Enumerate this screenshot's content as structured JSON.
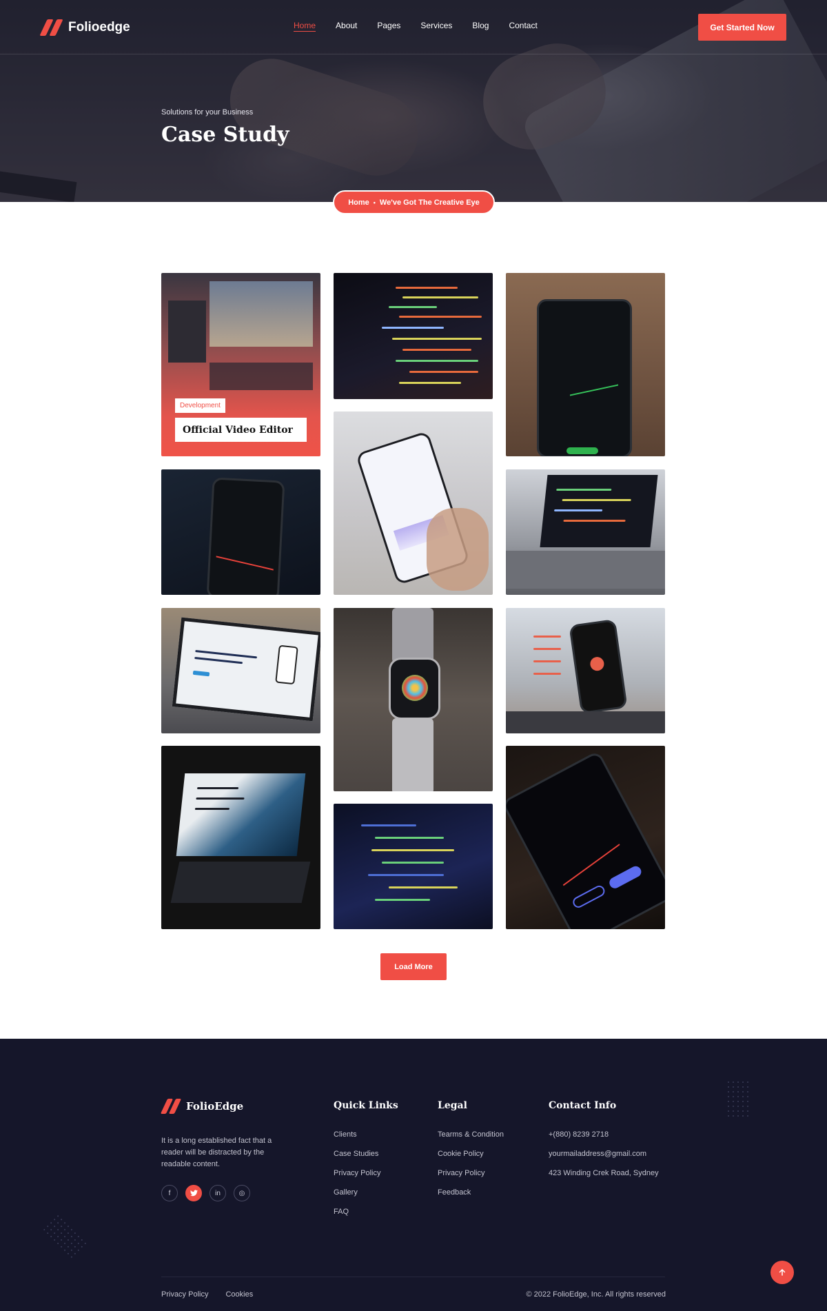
{
  "nav": {
    "brand": "Folioedge",
    "items": [
      {
        "label": "Home",
        "active": true
      },
      {
        "label": "About"
      },
      {
        "label": "Pages"
      },
      {
        "label": "Services"
      },
      {
        "label": "Blog"
      },
      {
        "label": "Contact"
      }
    ],
    "cta": "Get Started Now"
  },
  "hero": {
    "subtitle": "Solutions for your Business",
    "title": "Case Study"
  },
  "breadcrumb": {
    "home": "Home",
    "separator": "•",
    "current": "We've Got The Creative Eye"
  },
  "portfolio": {
    "featured": {
      "category": "Development",
      "title": "Official Video Editor"
    },
    "load_more": "Load More"
  },
  "footer": {
    "brand": "FolioEdge",
    "about": "It is a long established fact that a reader will be distracted by the readable content.",
    "socials": [
      {
        "icon": "facebook-icon",
        "glyph": "f"
      },
      {
        "icon": "twitter-icon",
        "glyph": "🐦",
        "active": true
      },
      {
        "icon": "linkedin-icon",
        "glyph": "in"
      },
      {
        "icon": "instagram-icon",
        "glyph": "◎"
      }
    ],
    "quick_links": {
      "heading": "Quick Links",
      "items": [
        "Clients",
        "Case Studies",
        "Privacy Policy",
        "Gallery",
        "FAQ"
      ]
    },
    "legal": {
      "heading": "Legal",
      "items": [
        "Tearms & Condition",
        "Cookie Policy",
        "Privacy Policy",
        "Feedback"
      ]
    },
    "contact": {
      "heading": "Contact Info",
      "items": [
        "+(880) 8239 2718",
        "yourmailaddress@gmail.com",
        "423 Winding Crek Road, Sydney"
      ]
    },
    "bottom_links": [
      "Privacy Policy",
      "Cookies"
    ],
    "copyright": "© 2022 FolioEdge, Inc. All rights reserved"
  },
  "colors": {
    "accent": "#f04e45",
    "footer_bg": "#15162a"
  }
}
